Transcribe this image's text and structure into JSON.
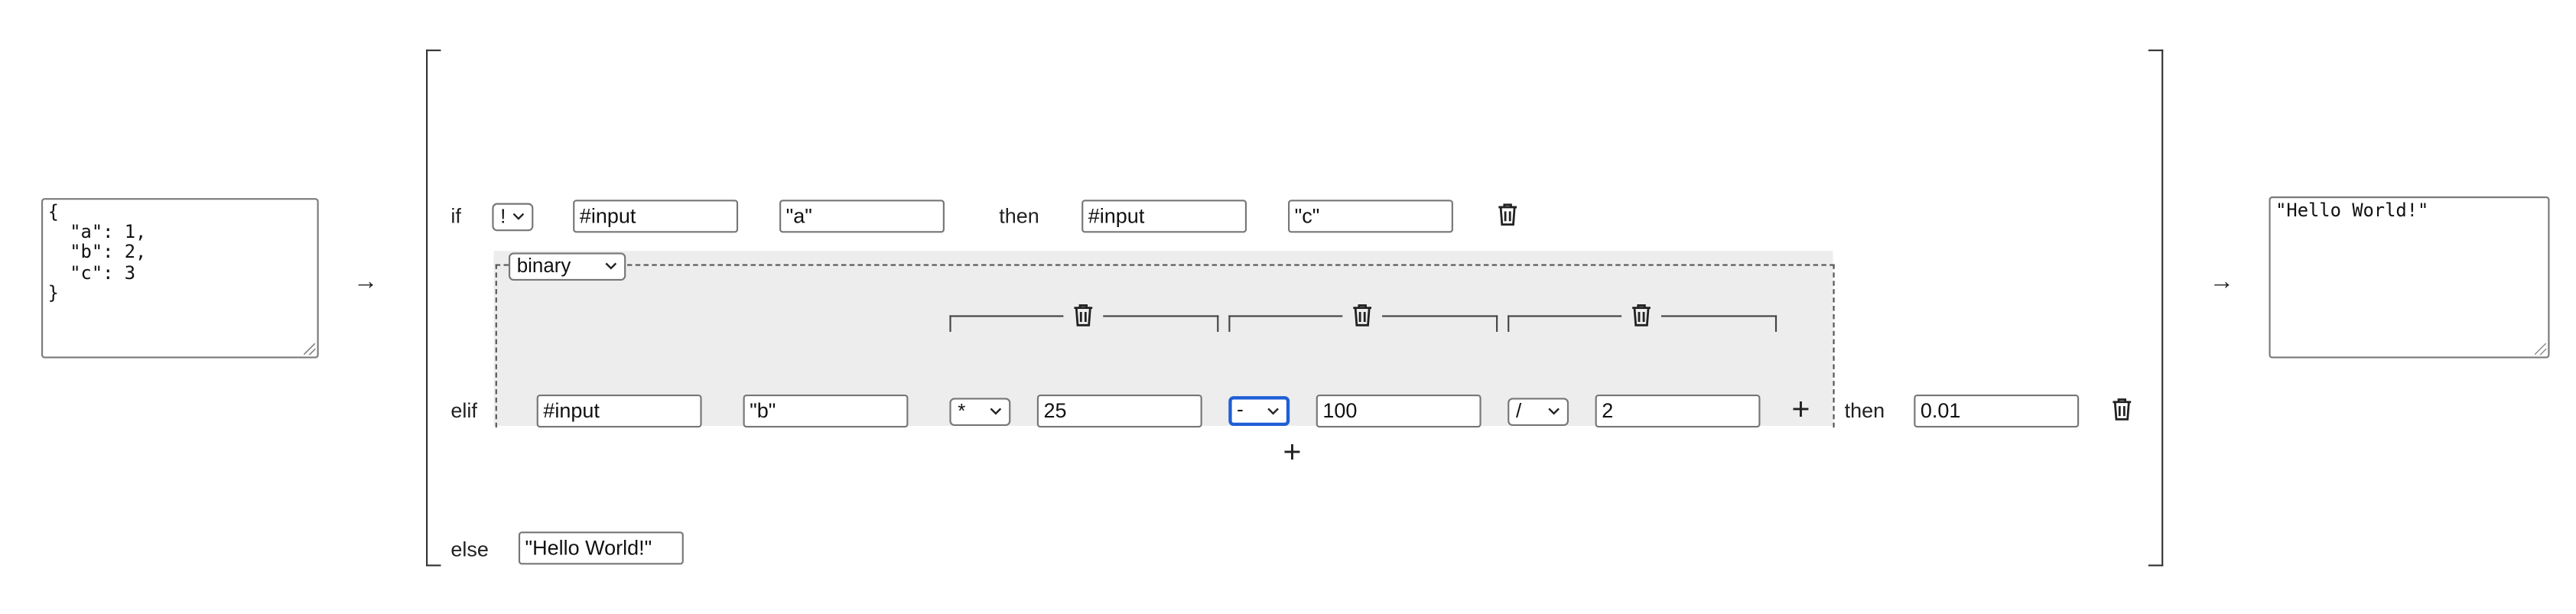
{
  "input_json": "{\n  \"a\": 1,\n  \"b\": 2,\n  \"c\": 3\n}",
  "output_json": "\"Hello World!\"",
  "arrows": {
    "left": "→",
    "right": "→"
  },
  "if_branch": {
    "keyword": "if",
    "operator": "!",
    "arg1": "#input",
    "arg2": "\"a\"",
    "then_keyword": "then",
    "then_arg1": "#input",
    "then_arg2": "\"c\""
  },
  "elif_branch": {
    "keyword": "elif",
    "mode": "binary",
    "arg1": "#input",
    "arg2": "\"b\"",
    "ops": [
      {
        "operator": "*",
        "value": "25"
      },
      {
        "operator": "-",
        "value": "100"
      },
      {
        "operator": "/",
        "value": "2"
      }
    ],
    "add_op_label": "+",
    "then_keyword": "then",
    "then_value": "0.01"
  },
  "add_branch_label": "+",
  "else_branch": {
    "keyword": "else",
    "value": "\"Hello World!\""
  },
  "icons": {
    "delete": "trash-icon",
    "dropdown": "chevron-down-icon",
    "resize": "resize-grip-icon"
  },
  "colors": {
    "focus_ring": "#1f5fd6",
    "binary_bg": "#ededed"
  }
}
